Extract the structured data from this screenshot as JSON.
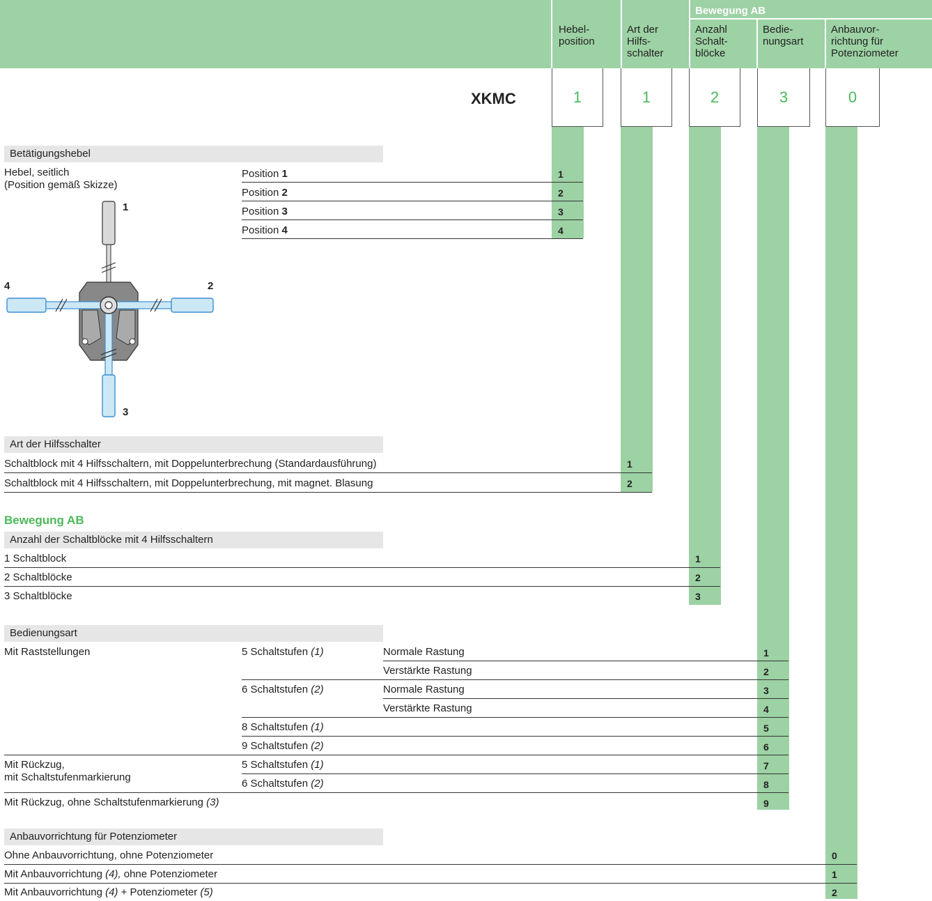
{
  "header": {
    "group_label": "Bewegung AB",
    "columns": [
      {
        "label": "Hebel-\nposition"
      },
      {
        "label": "Art der\nHilfs-\nschalter"
      },
      {
        "label": "Anzahl\nSchalt-\nblöcke"
      },
      {
        "label": "Bedie-\nnungsart"
      },
      {
        "label": "Anbauvor-\nrichtung für\nPotenziometer"
      }
    ]
  },
  "code": {
    "prefix": "XKMC",
    "digits": [
      "1",
      "1",
      "2",
      "3",
      "0"
    ]
  },
  "colors": {
    "band_green": "#9dd2a4",
    "accent_green": "#4cb85a",
    "section_grey": "#e6e6e6",
    "lever_blue": "#cde8f5"
  },
  "section_lever": {
    "heading": "Betätigungshebel",
    "desc_line1": "Hebel, seitlich",
    "desc_line2": "(Position gemäß Skizze)",
    "rows": [
      {
        "label": "Position ",
        "bold": "1",
        "code": "1"
      },
      {
        "label": "Position ",
        "bold": "2",
        "code": "2"
      },
      {
        "label": "Position ",
        "bold": "3",
        "code": "3"
      },
      {
        "label": "Position ",
        "bold": "4",
        "code": "4"
      }
    ],
    "diagram_labels": {
      "top": "1",
      "right": "2",
      "bottom": "3",
      "left": "4"
    }
  },
  "section_switch": {
    "heading": "Art der Hilfsschalter",
    "rows": [
      {
        "label": "Schaltblock mit 4 Hilfsschaltern, mit Doppelunterbrechung (Standardausführung)",
        "code": "1"
      },
      {
        "label": "Schaltblock mit 4 Hilfsschaltern, mit Doppelunterbrechung, mit magnet. Blasung",
        "code": "2"
      }
    ]
  },
  "movement_title": "Bewegung AB",
  "section_blocks": {
    "heading": "Anzahl der Schaltblöcke mit 4 Hilfsschaltern",
    "rows": [
      {
        "label": "1 Schaltblock",
        "code": "1"
      },
      {
        "label": "2 Schaltblöcke",
        "code": "2"
      },
      {
        "label": "3 Schaltblöcke",
        "code": "3"
      }
    ]
  },
  "section_operation": {
    "heading": "Bedienungsart",
    "group1": "Mit Raststellungen",
    "group2_line1": "Mit Rückzug,",
    "group2_line2": "mit Schaltstufenmarkierung",
    "group3": "Mit Rückzug, ohne Schaltstufenmarkierung ",
    "group3_note": "(3)",
    "steps": [
      {
        "label": "5 Schaltstufen ",
        "note": "(1)"
      },
      {
        "label": "6 Schaltstufen ",
        "note": "(2)"
      },
      {
        "label": "8 Schaltstufen ",
        "note": "(1)"
      },
      {
        "label": "9 Schaltstufen ",
        "note": "(2)"
      },
      {
        "label": "5 Schaltstufen ",
        "note": "(1)"
      },
      {
        "label": "6 Schaltstufen ",
        "note": "(2)"
      }
    ],
    "detents": [
      "Normale Rastung",
      "Verstärkte Rastung",
      "Normale Rastung",
      "Verstärkte Rastung"
    ],
    "codes": [
      "1",
      "2",
      "3",
      "4",
      "5",
      "6",
      "7",
      "8",
      "9"
    ]
  },
  "section_poti": {
    "heading": "Anbauvorrichtung für Potenziometer",
    "rows": [
      {
        "label": "Ohne Anbauvorrichtung, ohne Potenziometer",
        "code": "0"
      },
      {
        "pre": "Mit Anbauvorrichtung ",
        "note1": "(4),",
        "mid": " ohne Potenziometer",
        "note2": "",
        "code": "1"
      },
      {
        "pre": "Mit Anbauvorrichtung ",
        "note1": "(4)",
        "mid": " + Potenziometer ",
        "note2": "(5)",
        "code": "2"
      }
    ]
  }
}
